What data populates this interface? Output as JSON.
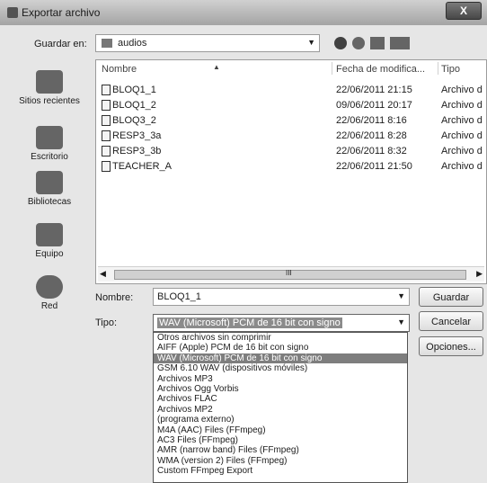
{
  "window": {
    "title": "Exportar archivo",
    "close_glyph": "X"
  },
  "save_in": {
    "label": "Guardar en:",
    "value": "audios",
    "icons": [
      "back-icon",
      "up-folder-icon",
      "new-folder-icon",
      "views-menu-icon"
    ]
  },
  "places": [
    {
      "label": "Sitios recientes",
      "icon": "recent-places-icon"
    },
    {
      "label": "Escritorio",
      "icon": "desktop-icon"
    },
    {
      "label": "Bibliotecas",
      "icon": "libraries-icon"
    },
    {
      "label": "Equipo",
      "icon": "computer-icon"
    },
    {
      "label": "Red",
      "icon": "network-icon"
    }
  ],
  "columns": {
    "name": "Nombre",
    "date": "Fecha de modifica...",
    "type": "Tipo"
  },
  "files": [
    {
      "name": "BLOQ1_1",
      "date": "22/06/2011 21:15",
      "type": "Archivo d"
    },
    {
      "name": "BLOQ1_2",
      "date": "09/06/2011 20:17",
      "type": "Archivo d"
    },
    {
      "name": "BLOQ3_2",
      "date": "22/06/2011 8:16",
      "type": "Archivo d"
    },
    {
      "name": "RESP3_3a",
      "date": "22/06/2011 8:28",
      "type": "Archivo d"
    },
    {
      "name": "RESP3_3b",
      "date": "22/06/2011 8:32",
      "type": "Archivo d"
    },
    {
      "name": "TEACHER_A",
      "date": "22/06/2011 21:50",
      "type": "Archivo d"
    }
  ],
  "filename": {
    "label": "Nombre:",
    "value": "BLOQ1_1"
  },
  "filetype": {
    "label": "Tipo:",
    "value": "WAV (Microsoft) PCM de 16 bit con signo"
  },
  "buttons": {
    "save": "Guardar",
    "cancel": "Cancelar",
    "options": "Opciones..."
  },
  "type_options": [
    "Otros archivos sin comprimir",
    "AIFF (Apple) PCM de 16 bit con signo",
    "WAV (Microsoft) PCM de 16 bit con signo",
    "GSM 6.10 WAV (dispositivos móviles)",
    "Archivos MP3",
    "Archivos Ogg Vorbis",
    "Archivos FLAC",
    "Archivos MP2",
    "(programa externo)",
    "M4A (AAC) Files (FFmpeg)",
    "AC3 Files (FFmpeg)",
    "AMR (narrow band) Files (FFmpeg)",
    "WMA (version 2) Files (FFmpeg)",
    "Custom FFmpeg Export"
  ],
  "selected_option_index": 2
}
